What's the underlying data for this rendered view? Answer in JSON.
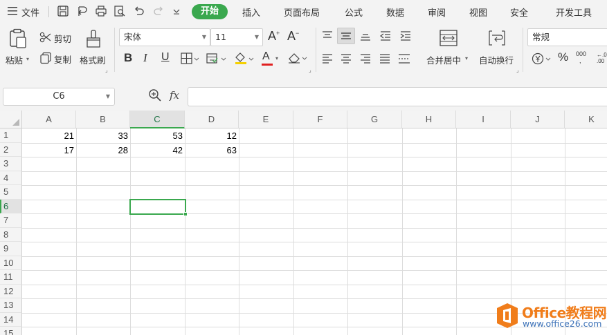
{
  "menu": {
    "file_label": "文件",
    "tabs": [
      {
        "label": "开始",
        "active": true
      },
      {
        "label": "插入"
      },
      {
        "label": "页面布局"
      },
      {
        "label": "公式"
      },
      {
        "label": "数据"
      },
      {
        "label": "审阅"
      },
      {
        "label": "视图"
      },
      {
        "label": "安全"
      },
      {
        "label": "开发工具"
      }
    ]
  },
  "ribbon": {
    "paste_label": "粘贴",
    "cut_label": "剪切",
    "copy_label": "复制",
    "format_painter_label": "格式刷",
    "font_name": "宋体",
    "font_size": "11",
    "increase_font": "A",
    "decrease_font": "A",
    "bold": "B",
    "italic": "I",
    "underline": "U",
    "font_color_letter": "A",
    "merge_center_label": "合并居中",
    "wrap_text_label": "自动换行",
    "number_format": "常规",
    "percent": "%",
    "thousands": "000",
    "accent_color": "#3aa84e",
    "font_color": "#e02020",
    "fill_color": "#f5d000"
  },
  "formula_bar": {
    "name_box": "C6",
    "fx_label": "fx",
    "formula_value": ""
  },
  "sheet": {
    "columns": [
      "A",
      "B",
      "C",
      "D",
      "E",
      "F",
      "G",
      "H",
      "I",
      "J",
      "K"
    ],
    "active_column": "C",
    "rows": [
      "1",
      "2",
      "3",
      "4",
      "5",
      "6",
      "7",
      "8",
      "9",
      "10",
      "11",
      "12",
      "13",
      "14",
      "15"
    ],
    "active_row": "6",
    "data": [
      [
        "21",
        "33",
        "53",
        "12"
      ],
      [
        "17",
        "28",
        "42",
        "63"
      ]
    ]
  },
  "watermark": {
    "title": "Office教程网",
    "url": "www.office26.com"
  }
}
